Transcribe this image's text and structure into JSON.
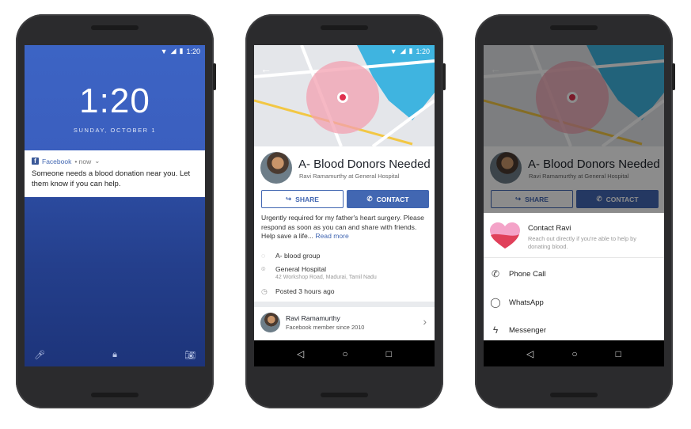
{
  "status": {
    "time": "1:20"
  },
  "lock_screen": {
    "time": "1:20",
    "date": "SUNDAY, OCTOBER 1",
    "notification": {
      "app": "Facebook",
      "meta": "• now",
      "body": "Someone needs a blood donation near you. Let them know if you can help."
    }
  },
  "post": {
    "title": "A- Blood Donors Needed",
    "subtitle": "Ravi Ramamurthy at General Hospital",
    "share_label": "SHARE",
    "contact_label": "CONTACT",
    "description": "Urgently required for my father's heart surgery. Please respond as soon as you can and share with friends. Help save a life...",
    "read_more": "Read more",
    "blood_group": "A- blood group",
    "location_name": "General Hospital",
    "location_address": "42 Workshop Road, Madurai, Tamil Nadu",
    "posted": "Posted 3 hours ago",
    "member_name": "Ravi Ramamurthy",
    "member_since": "Facebook member since 2010"
  },
  "contact_sheet": {
    "title": "Contact Ravi",
    "subtitle": "Reach out directly if you're able to help by donating blood.",
    "options": [
      {
        "label": "Phone Call",
        "icon": "phone-icon"
      },
      {
        "label": "WhatsApp",
        "icon": "whatsapp-icon"
      },
      {
        "label": "Messenger",
        "icon": "messenger-icon"
      }
    ]
  },
  "colors": {
    "facebook_blue": "#4267b2",
    "lock_blue": "#3b5fbf",
    "map_water": "#3fb4e0",
    "map_circle": "#f3a0b0"
  }
}
